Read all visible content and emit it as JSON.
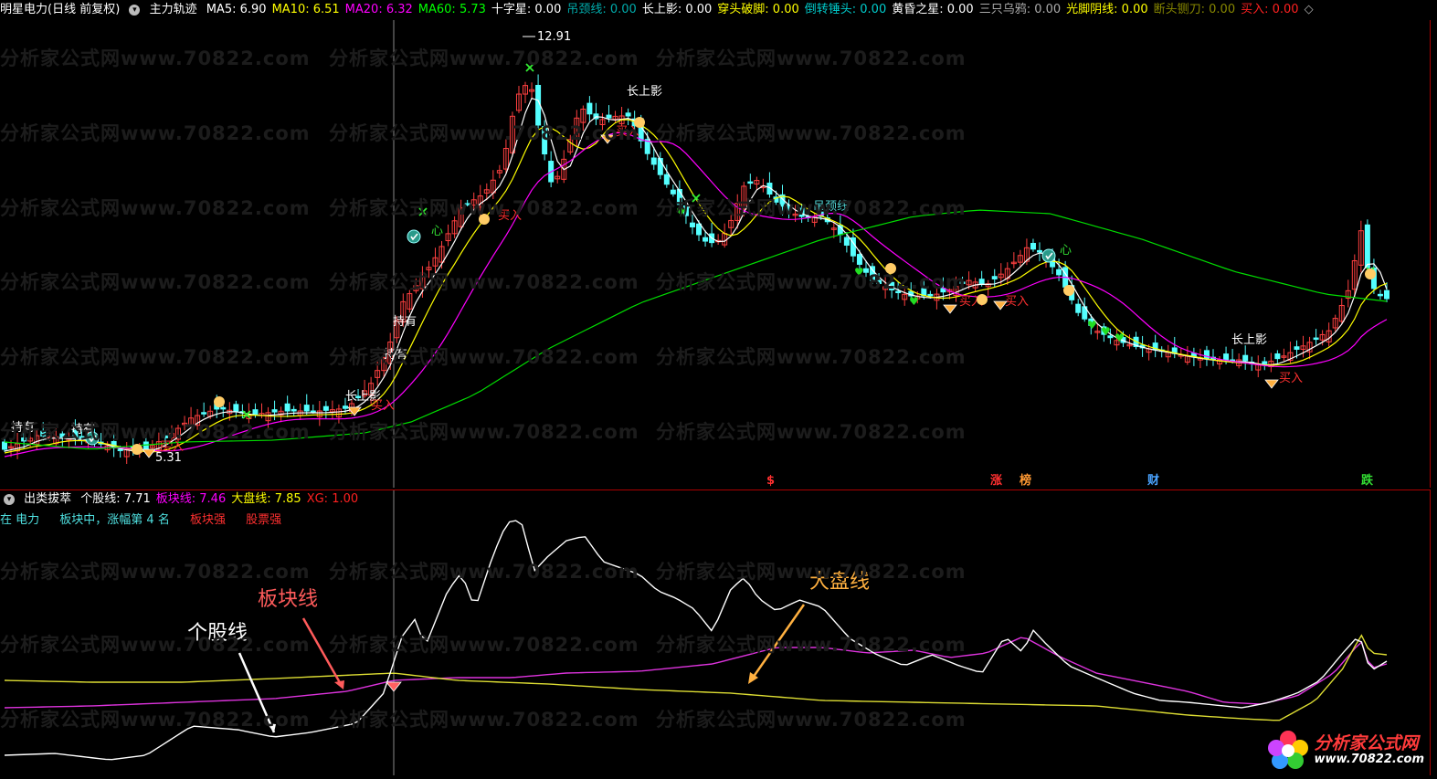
{
  "header": {
    "stock": "明星电力(日线 前复权)",
    "indicator": "主力轨迹",
    "items": [
      {
        "label": "MA5: 6.90",
        "color": "#ffffff"
      },
      {
        "label": "MA10: 6.51",
        "color": "#ffff00"
      },
      {
        "label": "MA20: 6.32",
        "color": "#ff00ff"
      },
      {
        "label": "MA60: 5.73",
        "color": "#00ff00"
      },
      {
        "label": "十字星: 0.00",
        "color": "#ffffff"
      },
      {
        "label": "吊颈线: 0.00",
        "color": "#00aaaa"
      },
      {
        "label": "长上影: 0.00",
        "color": "#ffffff"
      },
      {
        "label": "穿头破脚: 0.00",
        "color": "#ffff00"
      },
      {
        "label": "倒转锤头: 0.00",
        "color": "#00cccc"
      },
      {
        "label": "黄昏之星: 0.00",
        "color": "#ffffff"
      },
      {
        "label": "三只乌鸦: 0.00",
        "color": "#aaaaaa"
      },
      {
        "label": "光脚阴线: 0.00",
        "color": "#ffff00"
      },
      {
        "label": "断头铡刀: 0.00",
        "color": "#888800"
      },
      {
        "label": "买入: 0.00",
        "color": "#ff2020"
      }
    ],
    "end_icon": "◇"
  },
  "sub_header": {
    "indicator": "出类拔萃",
    "items": [
      {
        "label": "个股线: 7.71",
        "color": "#ffffff"
      },
      {
        "label": "板块线: 7.46",
        "color": "#ff00ff"
      },
      {
        "label": "大盘线: 7.85",
        "color": "#ffff00"
      },
      {
        "label": "XG: 1.00",
        "color": "#ff2020"
      }
    ]
  },
  "sub_legend": {
    "sector": "在 电力",
    "rank": "板块中，涨幅第 4 名",
    "strong_sector": "板块强",
    "strong_stock": "股票强"
  },
  "main_annotations": {
    "high_price": "12.91",
    "low_price": "5.31",
    "long_upper_shadow": "长上影",
    "hold": "持有",
    "buy": "买入",
    "neck_line": "吊颈线",
    "heart": "心",
    "bottom_tags": [
      {
        "text": "$",
        "color": "#ff3030"
      },
      {
        "text": "涨",
        "color": "#ff3030"
      },
      {
        "text": "榜",
        "color": "#ff9933"
      },
      {
        "text": "财",
        "color": "#4aa3ff"
      },
      {
        "text": "跌",
        "color": "#33dd33"
      }
    ]
  },
  "sub_annotations": {
    "stock_line": "个股线",
    "sector_line": "板块线",
    "market_line": "大盘线"
  },
  "watermark": "分析家公式网www.70822.com",
  "logo": {
    "name": "分析家公式网",
    "url": "www.70822.com"
  },
  "colors": {
    "up": "#ff4040",
    "down": "#54ffff",
    "ma5": "#ffffff",
    "ma10": "#ffff00",
    "ma20": "#ff00ff",
    "ma60": "#00dd00",
    "frame": "#aa0000"
  }
}
